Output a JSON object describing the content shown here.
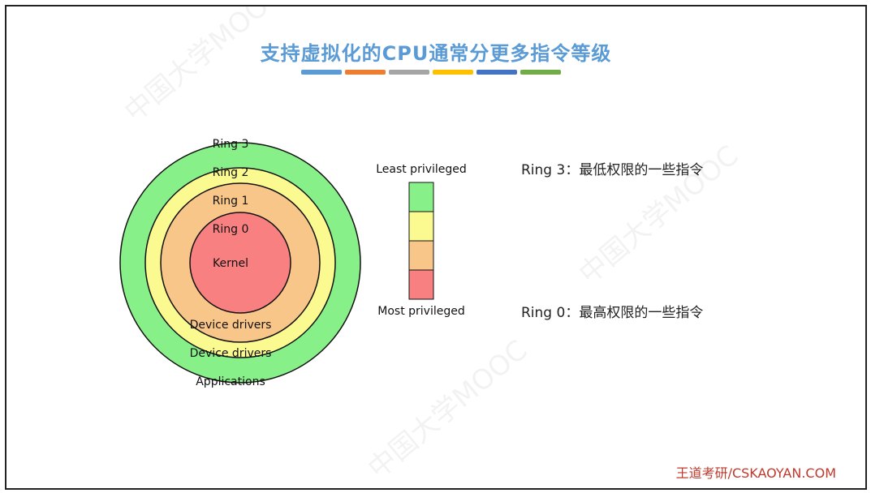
{
  "slide": {
    "title": "支持虚拟化的CPU通常分更多指令等级",
    "accent_bars": [
      "#5b9bd5",
      "#ed7d31",
      "#a5a5a5",
      "#ffc000",
      "#4472c4",
      "#70ad47"
    ]
  },
  "diagram": {
    "rings": [
      {
        "label": "Ring 3",
        "sublabel": "Applications",
        "color": "#88f088"
      },
      {
        "label": "Ring 2",
        "sublabel": "Device drivers",
        "color": "#fafa90"
      },
      {
        "label": "Ring 1",
        "sublabel": "Device drivers",
        "color": "#f9c68a"
      },
      {
        "label": "Ring 0",
        "sublabel": "Kernel",
        "color": "#f88080"
      }
    ],
    "stroke_color": "#111111",
    "privilege_scale": {
      "top_label": "Least privileged",
      "bottom_label": "Most privileged",
      "swatches": [
        "#88f088",
        "#fafa90",
        "#f9c68a",
        "#f88080"
      ]
    }
  },
  "notes": {
    "ring3": "Ring 3：最低权限的一些指令",
    "ring0": "Ring 0：最高权限的一些指令"
  },
  "footer": {
    "brand": "王道考研/CSKAOYAN.COM"
  },
  "watermark": {
    "text": "中国大学MOOC"
  }
}
